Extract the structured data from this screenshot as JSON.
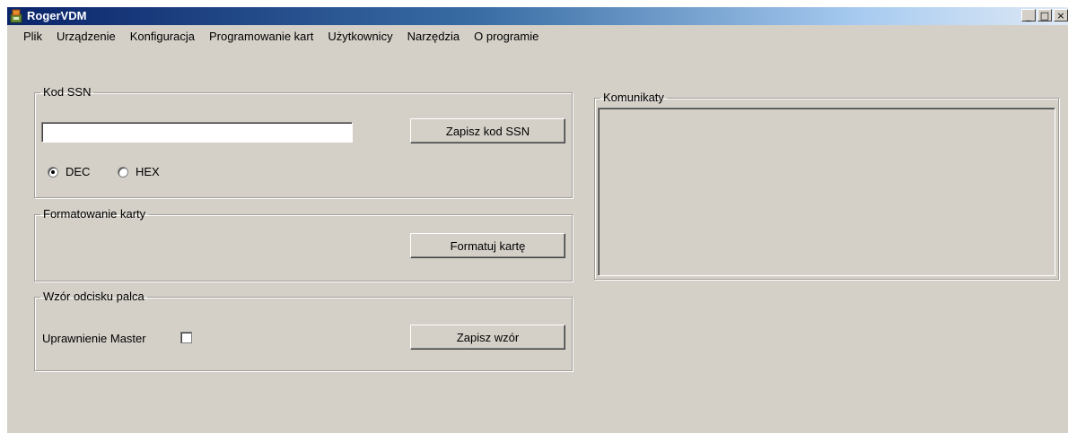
{
  "window": {
    "title": "RogerVDM",
    "controls": {
      "minimize": "_",
      "maximize": "□",
      "close": "×"
    }
  },
  "menu": {
    "items": [
      "Plik",
      "Urządzenie",
      "Konfiguracja",
      "Programowanie kart",
      "Użytkownicy",
      "Narzędzia",
      "O programie"
    ]
  },
  "ssn": {
    "legend": "Kod SSN",
    "input_value": "",
    "save_label": "Zapisz kod SSN",
    "radio_dec": "DEC",
    "radio_hex": "HEX",
    "selected": "DEC"
  },
  "format": {
    "legend": "Formatowanie karty",
    "button_label": "Formatuj kartę"
  },
  "fingerprint": {
    "legend": "Wzór odcisku palca",
    "master_label": "Uprawnienie Master",
    "master_checked": false,
    "save_label": "Zapisz wzór"
  },
  "messages": {
    "legend": "Komunikaty"
  }
}
